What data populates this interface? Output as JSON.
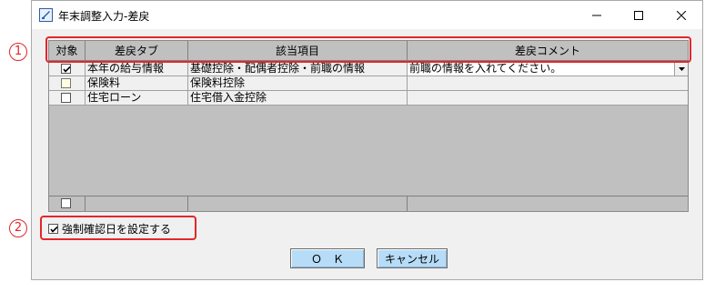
{
  "window": {
    "title": "年末調整入力-差戻",
    "icon": "app-window-icon",
    "controls": {
      "minimize": "minimize-icon",
      "maximize": "maximize-icon",
      "close": "close-icon"
    }
  },
  "grid": {
    "columns": [
      "対象",
      "差戻タブ",
      "該当項目",
      "差戻コメント"
    ],
    "rows": [
      {
        "checked": true,
        "tab": "本年の給与情報",
        "item": "基礎控除・配偶者控除・前職の情報",
        "comment": "前職の情報を入れてください。",
        "has_dropdown": true
      },
      {
        "checked": false,
        "tab": "保険料",
        "item": "保険料控除",
        "comment": "",
        "has_dropdown": false
      },
      {
        "checked": false,
        "tab": "住宅ローン",
        "item": "住宅借入金控除",
        "comment": "",
        "has_dropdown": false
      }
    ],
    "footer_checked": false
  },
  "options": {
    "force_confirm_label": "強制確認日を設定する",
    "force_confirm_checked": true
  },
  "buttons": {
    "ok": "Ｏ　Ｋ",
    "cancel": "キャンセル"
  },
  "annotations": {
    "marker1": "1",
    "marker2": "2"
  },
  "colors": {
    "highlight": "#e3262b",
    "button_bg": "#b6dcf7",
    "grid_bg": "#c0c0c0",
    "row_bg": "#f0f0f0"
  }
}
